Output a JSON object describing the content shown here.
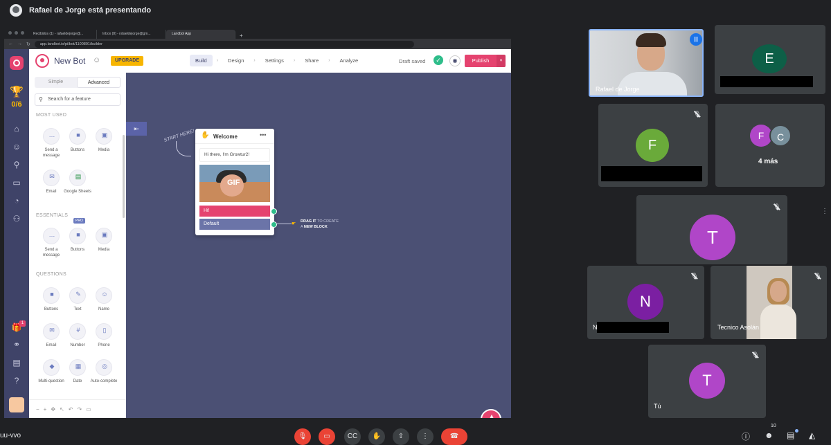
{
  "top_bar": {
    "presenter_text": "Rafael de Jorge está presentando"
  },
  "browser": {
    "tabs": [
      "Recibidos (1) - rafaeldejorge@...",
      "Inbox (8) - rafaeldejorge@gm...",
      "Landbot App"
    ],
    "url": "app.landbot.io/pi/bot/1100891/builder"
  },
  "landbot": {
    "bot_name": "New Bot",
    "upgrade_label": "UPGRADE",
    "nav_steps": [
      "Build",
      "Design",
      "Settings",
      "Share",
      "Analyze"
    ],
    "draft_status": "Draft saved",
    "publish_label": "Publish",
    "trophy_count": "0/6",
    "gift_badge": "1",
    "mode_tabs": [
      "Simple",
      "Advanced"
    ],
    "search_placeholder": "Search for a feature",
    "sections": {
      "most_used": "MOST USED",
      "essentials": "ESSENTIALS",
      "questions": "QUESTIONS"
    },
    "most_used_items": [
      "Send a message",
      "Buttons",
      "Media",
      "Email",
      "Google Sheets"
    ],
    "pro_badge": "PRO",
    "essentials_items": [
      "Send a message",
      "Buttons",
      "Media"
    ],
    "question_items": [
      "Buttons",
      "Text",
      "Name",
      "Email",
      "Number",
      "Phone",
      "Multi-question",
      "Date",
      "Auto-complete"
    ],
    "canvas": {
      "start_hint": "START HERE!",
      "card_title": "Welcome",
      "card_message": "Hi there, I'm Growtur2!",
      "gif_label": "GIF",
      "button_hi": "Hi!",
      "button_default": "Default",
      "drag_hint_1": "DRAG IT",
      "drag_hint_2": "TO CREATE",
      "drag_hint_3": "A",
      "drag_hint_4": "NEW BLOCK"
    }
  },
  "participants": {
    "rafael": "Rafael de Jorge",
    "e_initial": "E",
    "f_initial": "F",
    "group_initials": [
      "F",
      "C"
    ],
    "more_count": "4 más",
    "t_initial": "T",
    "n_initial": "N",
    "n_name_prefix": "N",
    "tecnico": "Tecnico Asolán",
    "tu_initial": "T",
    "tu_name": "Tú"
  },
  "colors": {
    "accent_pink": "#e5436f",
    "canvas_bg": "#4b5074",
    "meet_bg": "#202124",
    "tile_bg": "#3c4043",
    "e_avatar": "#0d5f47",
    "f_avatar": "#6aaa3a",
    "c_avatar": "#78909c",
    "t_avatar": "#b046c8",
    "n_avatar": "#7b1fa2"
  },
  "bottom_bar": {
    "meeting_code": "uu-vvo",
    "people_count": "10"
  }
}
